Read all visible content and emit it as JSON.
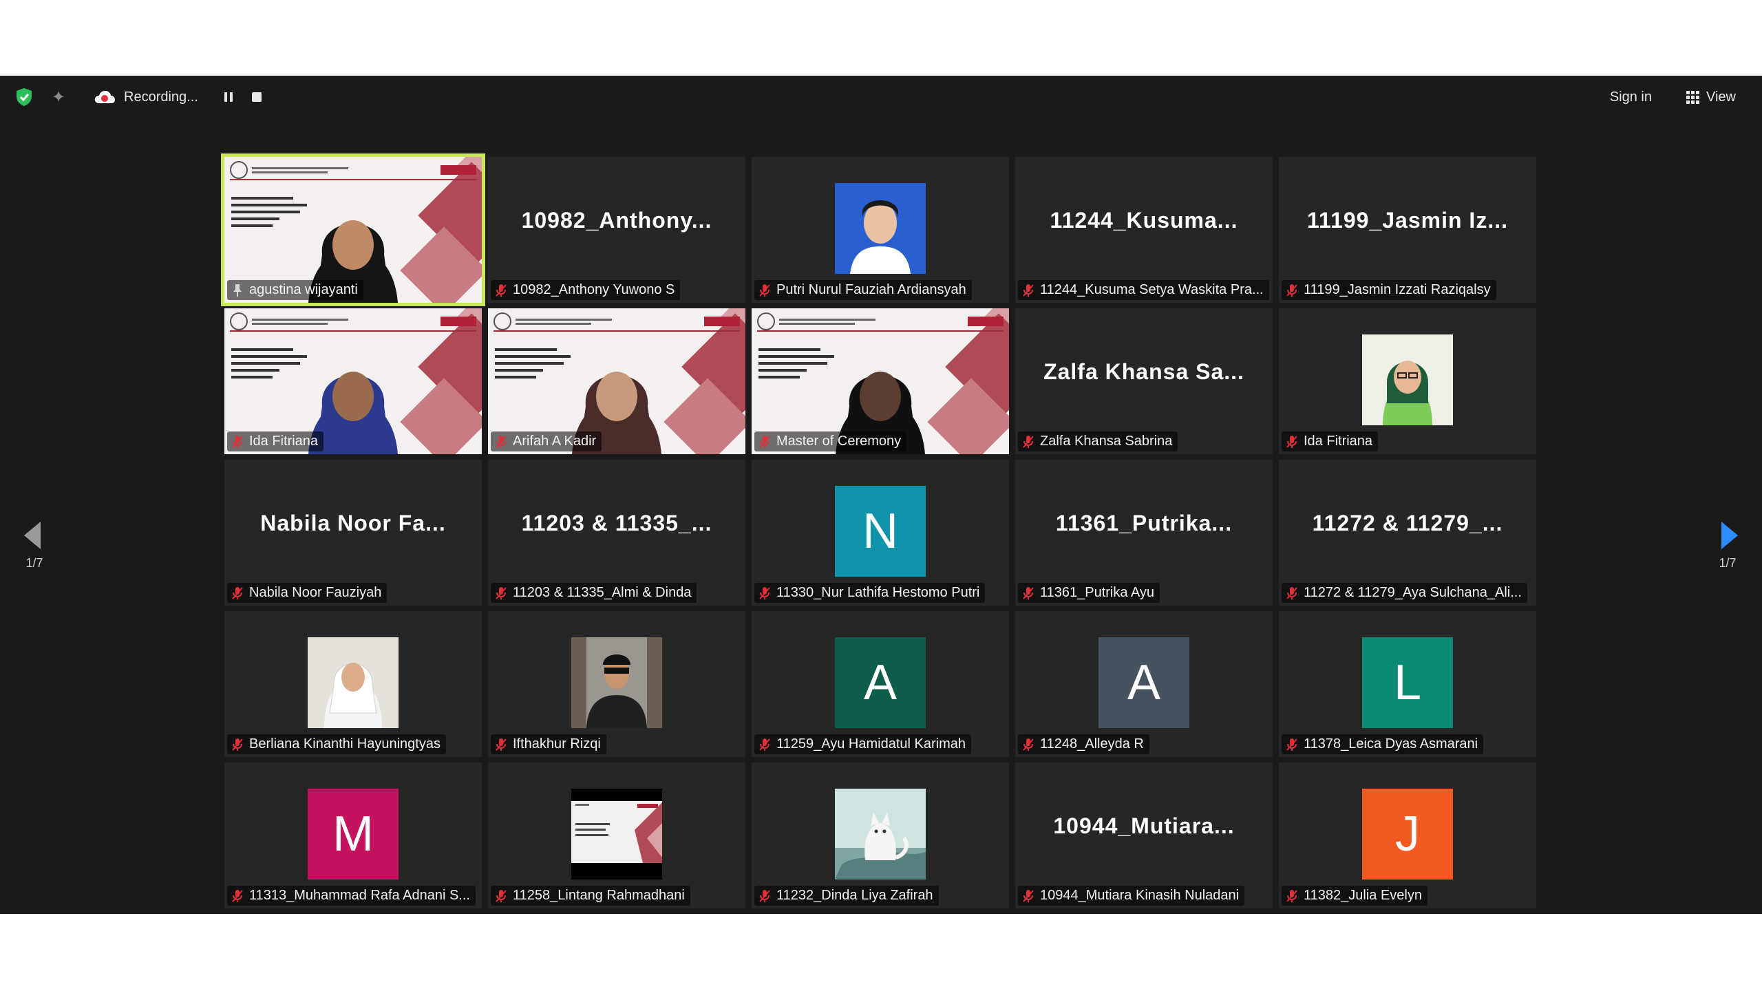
{
  "toolbar": {
    "recording_label": "Recording...",
    "sign_in_label": "Sign in",
    "view_label": "View",
    "icons": [
      "shield-check-icon",
      "sparkle-icon",
      "cloud-record-icon",
      "pause-icon",
      "stop-icon",
      "grid-view-icon"
    ],
    "colors": {
      "shield": "#2ebf5a",
      "record": "#e0303a"
    }
  },
  "navigation": {
    "prev_page_label": "1/7",
    "next_page_label": "1/7",
    "colors": {
      "prev_arrow": "#9a9a9a",
      "next_arrow": "#2d8cff"
    }
  },
  "grid": {
    "active_color": "#c8e85a",
    "tiles": [
      {
        "type": "video",
        "label": "agustina wijayanti",
        "pinned": true,
        "active": true
      },
      {
        "type": "name",
        "big_name": "10982_Anthony...",
        "label": "10982_Anthony Yuwono S"
      },
      {
        "type": "photo",
        "label": "Putri Nurul Fauziah Ardiansyah",
        "photo": "blue-portrait"
      },
      {
        "type": "name",
        "big_name": "11244_Kusuma...",
        "label": "11244_Kusuma Setya Waskita Pra..."
      },
      {
        "type": "name",
        "big_name": "11199_Jasmin  Iz...",
        "label": "11199_Jasmin Izzati Raziqalsy"
      },
      {
        "type": "video",
        "label": "Ida Fitriana"
      },
      {
        "type": "video",
        "label": "Arifah A Kadir"
      },
      {
        "type": "video",
        "label": "Master of Ceremony"
      },
      {
        "type": "name",
        "big_name": "Zalfa  Khansa  Sa...",
        "label": "Zalfa Khansa Sabrina"
      },
      {
        "type": "photo",
        "label": "Ida Fitriana",
        "photo": "green-portrait"
      },
      {
        "type": "name",
        "big_name": "Nabila  Noor  Fa...",
        "label": "Nabila Noor Fauziyah"
      },
      {
        "type": "name",
        "big_name": "11203 & 11335_...",
        "label": "11203 & 11335_Almi & Dinda"
      },
      {
        "type": "avatar",
        "letter": "N",
        "color": "#0f93aa",
        "label": "11330_Nur Lathifa Hestomo Putri"
      },
      {
        "type": "name",
        "big_name": "11361_Putrika...",
        "label": "11361_Putrika Ayu"
      },
      {
        "type": "name",
        "big_name": "11272 & 11279_...",
        "label": "11272 & 11279_Aya Sulchana_Ali..."
      },
      {
        "type": "photo",
        "label": "Berliana Kinanthi Hayuningtyas",
        "photo": "hijab-portrait"
      },
      {
        "type": "photo",
        "label": "Ifthakhur Rizqi",
        "photo": "dark-portrait"
      },
      {
        "type": "avatar",
        "letter": "A",
        "color": "#0c5e4a",
        "label": "11259_Ayu Hamidatul Karimah"
      },
      {
        "type": "avatar",
        "letter": "A",
        "color": "#46535e",
        "label": "11248_Alleyda R"
      },
      {
        "type": "avatar",
        "letter": "L",
        "color": "#0b8b73",
        "label": "11378_Leica Dyas Asmarani"
      },
      {
        "type": "avatar",
        "letter": "M",
        "color": "#c4135e",
        "label": "11313_Muhammad Rafa Adnani S..."
      },
      {
        "type": "photo",
        "label": "11258_Lintang Rahmadhani",
        "photo": "slide-thumb"
      },
      {
        "type": "photo",
        "label": "11232_Dinda Liya Zafirah",
        "photo": "cat-art"
      },
      {
        "type": "name",
        "big_name": "10944_Mutiara...",
        "label": "10944_Mutiara Kinasih Nuladani"
      },
      {
        "type": "avatar",
        "letter": "J",
        "color": "#f25a22",
        "label": "11382_Julia Evelyn"
      }
    ]
  }
}
